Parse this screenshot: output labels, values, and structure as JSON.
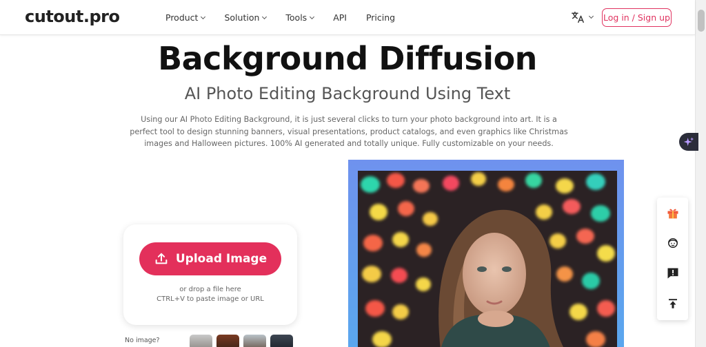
{
  "header": {
    "logo": "cutout.pro",
    "nav": [
      {
        "label": "Product",
        "dropdown": true
      },
      {
        "label": "Solution",
        "dropdown": true
      },
      {
        "label": "Tools",
        "dropdown": true
      },
      {
        "label": "API",
        "dropdown": false
      },
      {
        "label": "Pricing",
        "dropdown": false
      }
    ],
    "language_icon": "translate-icon",
    "login_label": "Log in / Sign up"
  },
  "hero": {
    "title": "Background Diffusion",
    "subtitle": "AI Photo Editing Background Using Text",
    "description": "Using our AI Photo Editing Background, it is just several clicks to turn your photo background into art. It is a perfect tool to design stunning banners, visual presentations, product catalogs, and even graphics like Christmas images and Halloween pictures. 100% AI generated and totally unique. Fully customizable on your needs."
  },
  "upload": {
    "button_label": "Upload Image",
    "drop_hint": "or drop a file here",
    "paste_hint": "CTRL+V to paste image or URL",
    "no_image_label": "No image?"
  },
  "side_tools": [
    "gift-icon",
    "support-agent-icon",
    "feedback-icon",
    "back-to-top-icon"
  ],
  "colors": {
    "accent": "#e3305b",
    "frame_blue": "#6f92ee",
    "ai_button": "#2b2d3a"
  }
}
